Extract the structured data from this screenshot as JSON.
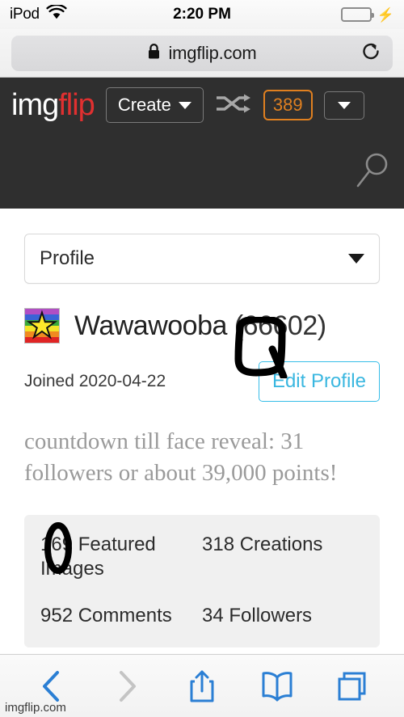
{
  "status_bar": {
    "carrier": "iPod",
    "wifi_icon": "wifi-icon",
    "time": "2:20 PM",
    "battery_icon": "battery-icon",
    "charging_icon": "lightning-bolt-icon",
    "battery_color": "#4cd964"
  },
  "browser": {
    "lock_icon": "lock-icon",
    "url": "imgflip.com",
    "reload_icon": "reload-icon",
    "toolbar": {
      "back_icon": "chevron-left-icon",
      "forward_icon": "chevron-right-icon",
      "share_icon": "share-icon",
      "bookmarks_icon": "book-icon",
      "tabs_icon": "tabs-icon",
      "back_enabled_color": "#2b7fd4",
      "forward_disabled_color": "#c4c4c4"
    }
  },
  "site_header": {
    "logo_part1": "img",
    "logo_part2": "flip",
    "logo_color_1": "#ffffff",
    "logo_color_2": "#e03030",
    "create_label": "Create",
    "create_caret_icon": "caret-down-icon",
    "shuffle_icon": "shuffle-icon",
    "points": "389",
    "points_color": "#e08020",
    "dropdown_icon": "caret-down-icon",
    "search_icon": "search-icon",
    "background_color": "#2f2f2f"
  },
  "profile": {
    "section_select": {
      "value": "Profile",
      "caret_icon": "caret-down-icon"
    },
    "avatar_icon": "rainbow-star-avatar",
    "username": "Wawawooba",
    "points_suffix": "(66602)",
    "joined": "Joined 2020-04-22",
    "edit_profile_label": "Edit Profile",
    "edit_profile_color": "#3ab7e0",
    "bio": "countdown till face reveal: 31 followers or about 39,000 points!",
    "stats": [
      "169 Featured Images",
      "318 Creations",
      "952 Comments",
      "34 Followers"
    ]
  },
  "annotations": {
    "username_circle": "hand-drawn-circle-annotation",
    "featured_circle": "hand-drawn-oval-annotation",
    "color": "#000000"
  },
  "watermark": "imgflip.com"
}
